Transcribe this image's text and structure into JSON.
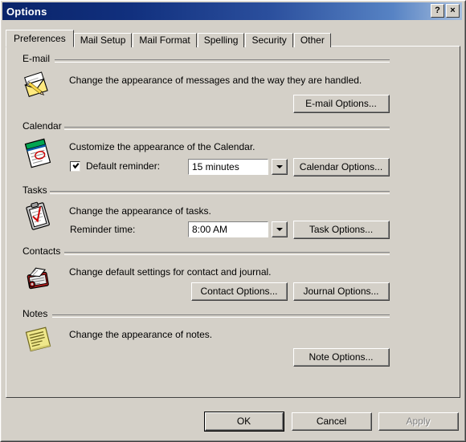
{
  "window": {
    "title": "Options",
    "help_button": "?",
    "close_button": "×"
  },
  "tabs": [
    {
      "label": "Preferences",
      "active": true
    },
    {
      "label": "Mail Setup",
      "active": false
    },
    {
      "label": "Mail Format",
      "active": false
    },
    {
      "label": "Spelling",
      "active": false
    },
    {
      "label": "Security",
      "active": false
    },
    {
      "label": "Other",
      "active": false
    }
  ],
  "sections": {
    "email": {
      "label": "E-mail",
      "icon": "envelope-pencil-icon",
      "description": "Change the appearance of messages and the way they are handled.",
      "button": "E-mail Options..."
    },
    "calendar": {
      "label": "Calendar",
      "icon": "calendar-page-icon",
      "description": "Customize the appearance of the Calendar.",
      "checkbox_label": "Default reminder:",
      "checkbox_checked": true,
      "combo_value": "15 minutes",
      "button": "Calendar Options..."
    },
    "tasks": {
      "label": "Tasks",
      "icon": "clipboard-check-icon",
      "description": "Change the appearance of tasks.",
      "field_label": "Reminder time:",
      "combo_value": "8:00 AM",
      "button": "Task Options..."
    },
    "contacts": {
      "label": "Contacts",
      "icon": "address-book-icon",
      "description": "Change default settings for contact and journal.",
      "button_contact": "Contact Options...",
      "button_journal": "Journal Options..."
    },
    "notes": {
      "label": "Notes",
      "icon": "sticky-note-icon",
      "description": "Change the appearance of notes.",
      "button": "Note Options..."
    }
  },
  "footer": {
    "ok": "OK",
    "cancel": "Cancel",
    "apply": "Apply",
    "apply_disabled": true
  },
  "colors": {
    "dialog_face": "#d4d0c8",
    "titlebar_start": "#0a246a",
    "titlebar_end": "#a6bede",
    "field_bg": "#ffffff",
    "text": "#000000",
    "disabled_text": "#808080"
  }
}
